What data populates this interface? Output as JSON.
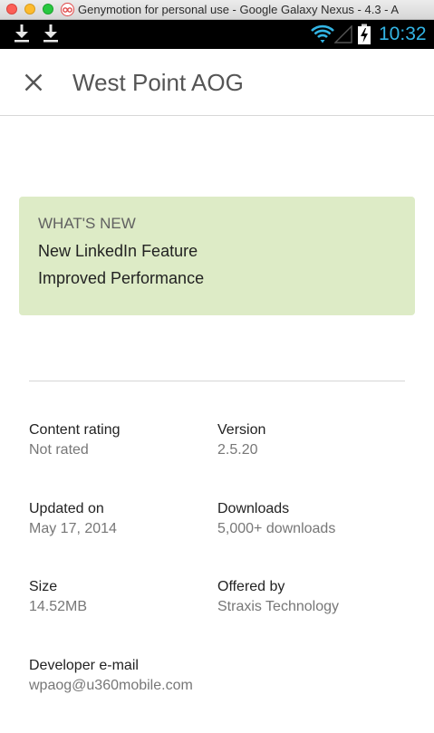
{
  "window": {
    "title": "Genymotion for personal use - Google Galaxy Nexus - 4.3 - A"
  },
  "status_bar": {
    "time": "10:32",
    "notification_icons": [
      "download-icon",
      "download-icon"
    ],
    "system_icons": [
      "wifi-icon",
      "signal-icon",
      "battery-charging-icon"
    ],
    "clock_color": "#33b5e5"
  },
  "app_bar": {
    "close_icon": "close-icon",
    "title": "West Point AOG"
  },
  "whats_new": {
    "heading": "WHAT'S NEW",
    "lines": [
      "New LinkedIn Feature",
      "Improved Performance"
    ],
    "background_color": "#ddebc6"
  },
  "details": {
    "content_rating": {
      "label": "Content rating",
      "value": "Not rated"
    },
    "version": {
      "label": "Version",
      "value": "2.5.20"
    },
    "updated_on": {
      "label": "Updated on",
      "value": "May 17, 2014"
    },
    "downloads": {
      "label": "Downloads",
      "value": "5,000+ downloads"
    },
    "size": {
      "label": "Size",
      "value": "14.52MB"
    },
    "offered_by": {
      "label": "Offered by",
      "value": "Straxis Technology"
    },
    "developer_email": {
      "label": "Developer e-mail",
      "value": "wpaog@u360mobile.com"
    }
  }
}
